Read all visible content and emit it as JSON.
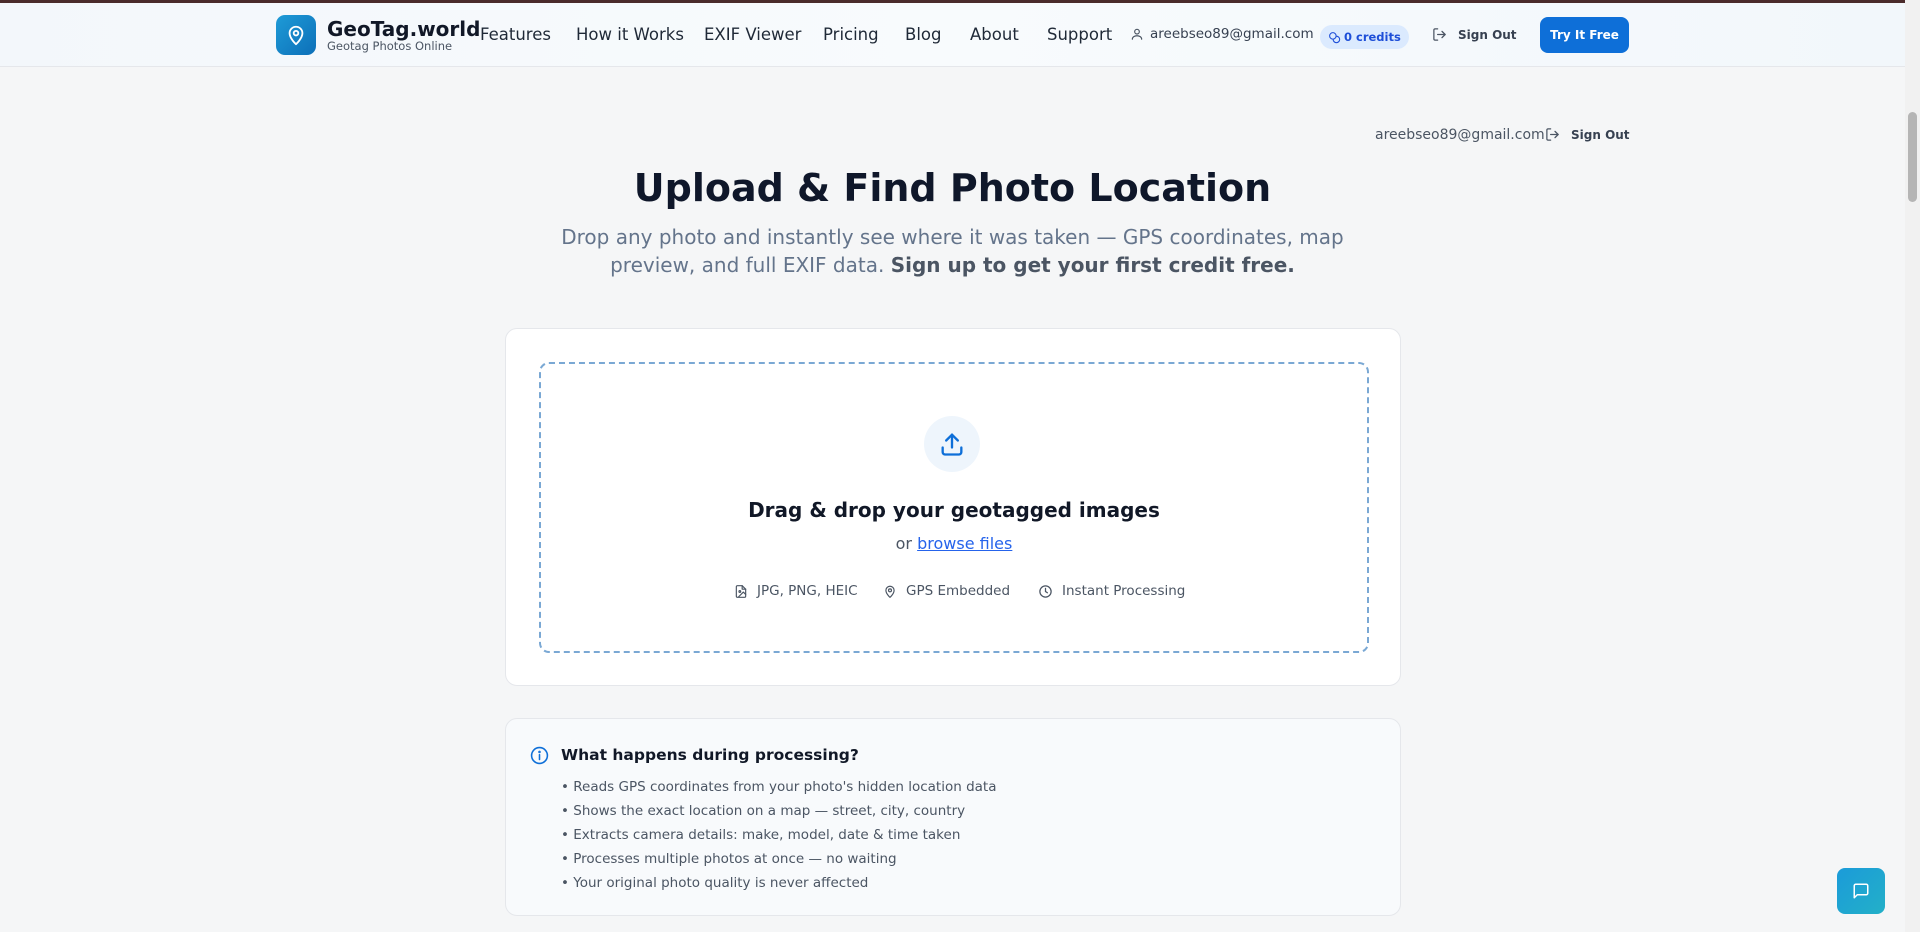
{
  "nav": {
    "brand_title": "GeoTag.world",
    "brand_subtitle": "Geotag Photos Online",
    "links": [
      "Features",
      "How it Works",
      "EXIF Viewer",
      "Pricing",
      "Blog",
      "About",
      "Support"
    ],
    "user_email": "areebseo89@gmail.com",
    "credits": "0 credits",
    "sign_out": "Sign Out",
    "try_free": "Try It Free"
  },
  "header": {
    "user_email": "areebseo89@gmail.com",
    "sign_out": "Sign Out"
  },
  "hero": {
    "title": "Upload & Find Photo Location",
    "subtitle": "Drop any photo and instantly see where it was taken — GPS coordinates, map preview, and full EXIF data.",
    "subtitle_bold": "Sign up to get your first credit free."
  },
  "upload": {
    "title": "Drag & drop your geotagged images",
    "or_text": "or",
    "browse_link": "browse files",
    "features": [
      "JPG, PNG, HEIC",
      "GPS Embedded",
      "Instant Processing"
    ]
  },
  "info": {
    "title": "What happens during processing?",
    "items": [
      "• Reads GPS coordinates from your photo's hidden location data",
      "• Shows the exact location on a map — street, city, country",
      "• Extracts camera details: make, model, date & time taken",
      "• Processes multiple photos at once — no waiting",
      "• Your original photo quality is never affected"
    ]
  },
  "colors": {
    "accent": "#0e6fd8",
    "brand": "#1e9bd7",
    "dropzone_border": "#7aa8d4"
  }
}
